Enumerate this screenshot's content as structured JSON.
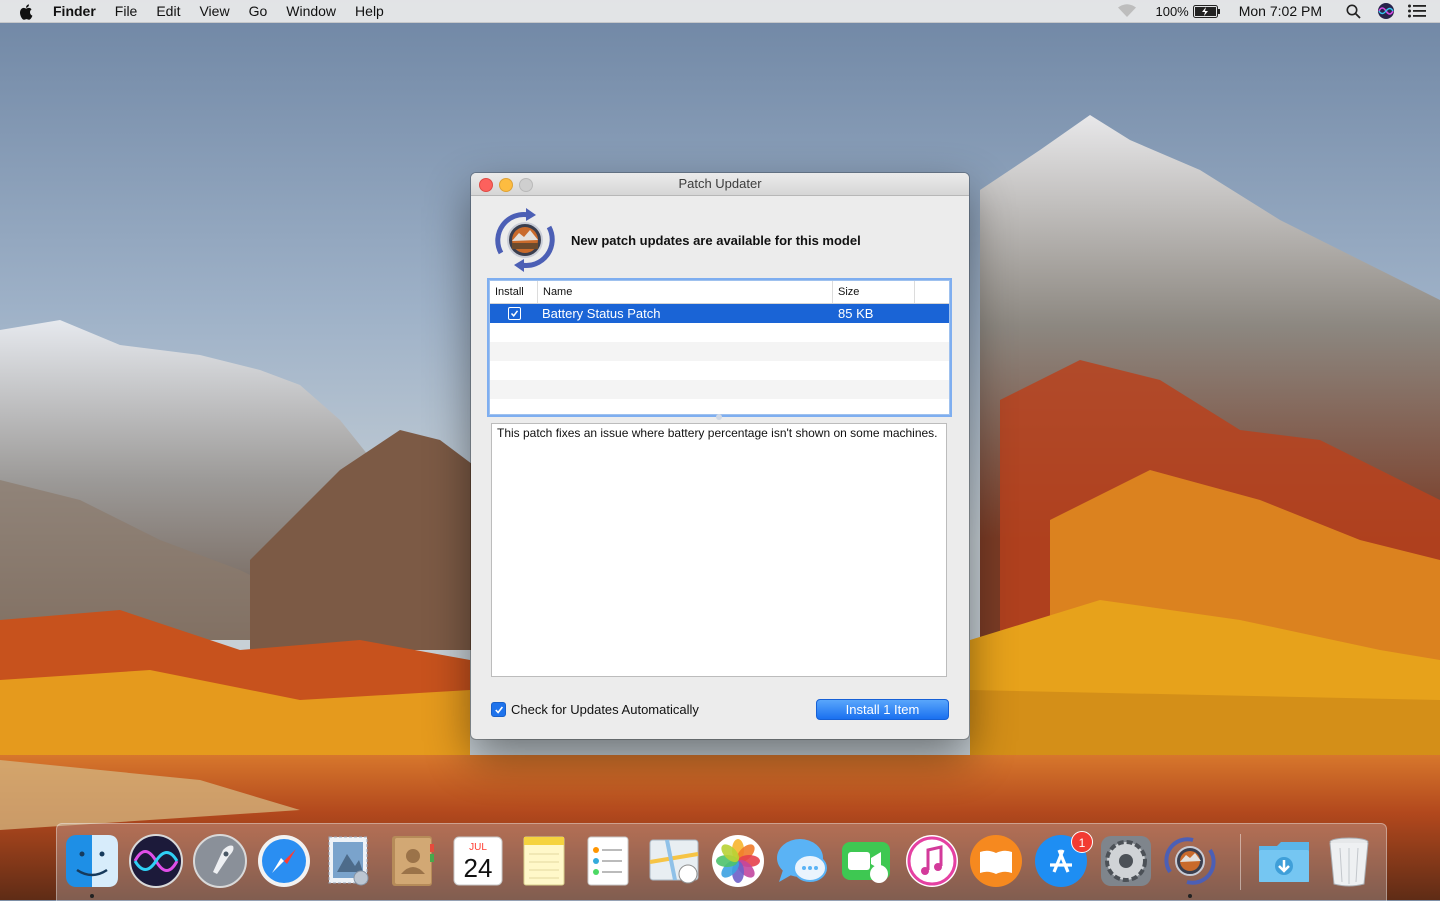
{
  "menubar": {
    "items": [
      "Finder",
      "File",
      "Edit",
      "View",
      "Go",
      "Window",
      "Help"
    ],
    "battery_text": "100%",
    "clock": "Mon 7:02 PM"
  },
  "window": {
    "title": "Patch Updater",
    "headline": "New patch updates are available for this model",
    "table": {
      "columns": [
        "Install",
        "Name",
        "Size"
      ],
      "rows": [
        {
          "install": true,
          "name": "Battery Status Patch",
          "size": "85 KB"
        }
      ]
    },
    "description": "This patch fixes an issue where battery percentage isn't shown on some machines.",
    "auto_check_label": "Check for Updates Automatically",
    "auto_check_checked": true,
    "install_button": "Install 1 Item"
  },
  "dock": {
    "calendar_month": "JUL",
    "calendar_day": "24",
    "appstore_badge": "1"
  }
}
